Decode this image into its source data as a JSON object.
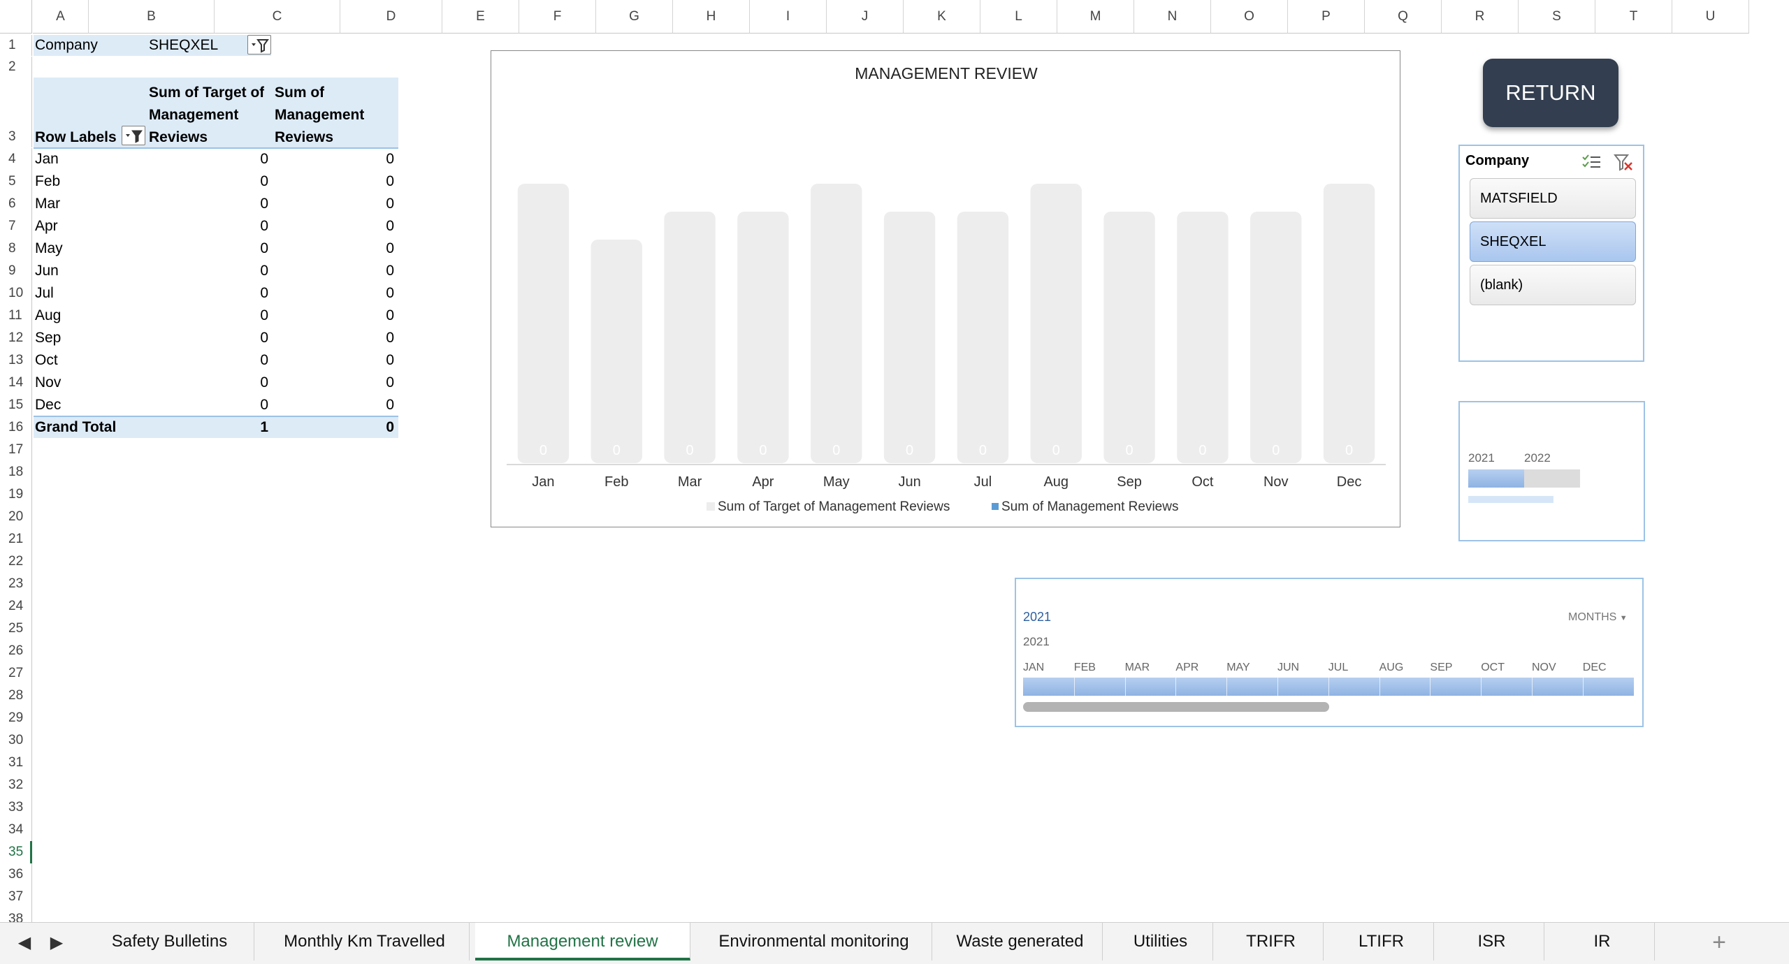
{
  "columns": [
    "A",
    "B",
    "C",
    "D",
    "E",
    "F",
    "G",
    "H",
    "I",
    "J",
    "K",
    "L",
    "M",
    "N",
    "O",
    "P",
    "Q",
    "R",
    "S",
    "T",
    "U"
  ],
  "rows": [
    "1",
    "2",
    "3",
    "4",
    "5",
    "6",
    "7",
    "8",
    "9",
    "10",
    "11",
    "12",
    "13",
    "14",
    "15",
    "16",
    "17",
    "18",
    "19",
    "20",
    "21",
    "22",
    "23",
    "24",
    "25",
    "26",
    "27",
    "28",
    "29",
    "30",
    "31",
    "32",
    "33",
    "34",
    "35",
    "36",
    "37",
    "38"
  ],
  "active_row": "35",
  "sheet": {
    "a1": "Company",
    "b1": "SHEQXEL",
    "header_row_labels": "Row Labels",
    "header_target_1": "Sum of Target of",
    "header_target_2": "Management",
    "header_target_3": "Reviews",
    "header_sum_1": "Sum of",
    "header_sum_2": "Management",
    "header_sum_3": "Reviews",
    "months": [
      "Jan",
      "Feb",
      "Mar",
      "Apr",
      "May",
      "Jun",
      "Jul",
      "Aug",
      "Sep",
      "Oct",
      "Nov",
      "Dec"
    ],
    "target_values": [
      "0",
      "0",
      "0",
      "0",
      "0",
      "0",
      "0",
      "0",
      "0",
      "0",
      "0",
      "0"
    ],
    "sum_values": [
      "0",
      "0",
      "0",
      "0",
      "0",
      "0",
      "0",
      "0",
      "0",
      "0",
      "0",
      "0"
    ],
    "grand_total_label": "Grand Total",
    "grand_total_target": "1",
    "grand_total_sum": "0"
  },
  "chart_data": {
    "type": "bar",
    "title": "MANAGEMENT REVIEW",
    "categories": [
      "Jan",
      "Feb",
      "Mar",
      "Apr",
      "May",
      "Jun",
      "Jul",
      "Aug",
      "Sep",
      "Oct",
      "Nov",
      "Dec"
    ],
    "series": [
      {
        "name": "Sum of Target of Management Reviews",
        "values": [
          0.1,
          0.08,
          0.09,
          0.09,
          0.1,
          0.09,
          0.09,
          0.1,
          0.09,
          0.09,
          0.09,
          0.1
        ],
        "color": "#ededed"
      },
      {
        "name": "Sum of Management Reviews",
        "values": [
          0,
          0,
          0,
          0,
          0,
          0,
          0,
          0,
          0,
          0,
          0,
          0
        ],
        "color": "#5b9bd5"
      }
    ],
    "data_labels": [
      "0",
      "0",
      "0",
      "0",
      "0",
      "0",
      "0",
      "0",
      "0",
      "0",
      "0",
      "0"
    ],
    "ylim": [
      0,
      0.12
    ],
    "legend": "bottom"
  },
  "return_button": "RETURN",
  "slicer": {
    "title": "Company",
    "items": [
      "MATSFIELD",
      "SHEQXEL",
      "(blank)"
    ],
    "selected": "SHEQXEL"
  },
  "year_box": {
    "years": [
      "2021",
      "2022"
    ]
  },
  "timeline": {
    "selected_label": "2021",
    "level": "MONTHS",
    "year": "2021",
    "months": [
      "JAN",
      "FEB",
      "MAR",
      "APR",
      "MAY",
      "JUN",
      "JUL",
      "AUG",
      "SEP",
      "OCT",
      "NOV",
      "DEC"
    ]
  },
  "tabs": [
    "Safety Bulletins",
    "Monthly Km Travelled",
    "Management review",
    "Environmental monitoring",
    "Waste generated",
    "Utilities",
    "TRIFR",
    "LTIFR",
    "ISR",
    "IR"
  ],
  "active_tab": "Management review",
  "colors": {
    "accent": "#217346",
    "header_fill": "#ddebf7",
    "button": "#333f50"
  }
}
